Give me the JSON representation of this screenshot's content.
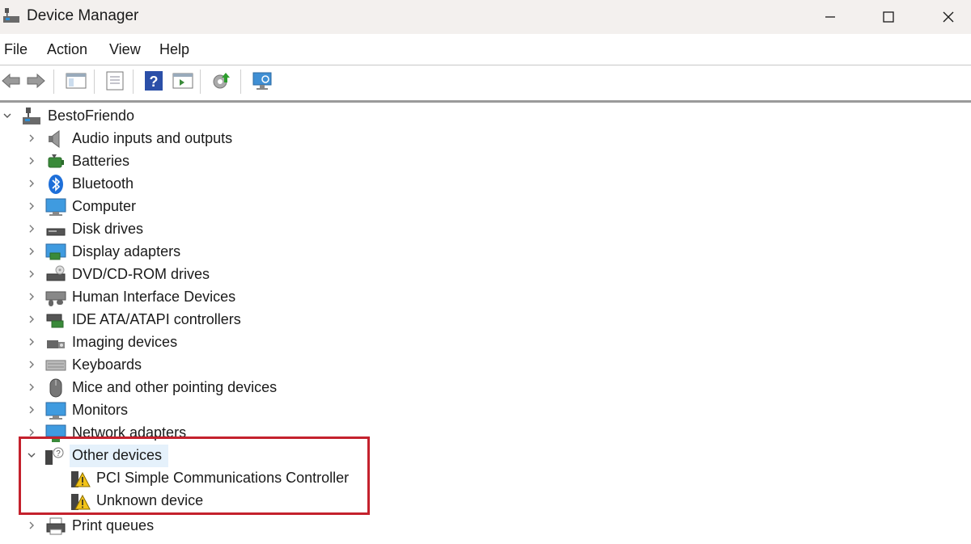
{
  "window": {
    "title": "Device Manager"
  },
  "menu": [
    "File",
    "Action",
    "View",
    "Help"
  ],
  "toolbar": {
    "buttons": [
      "back-icon",
      "forward-icon",
      "show-hide-console-tree-icon",
      "properties-icon",
      "help-icon",
      "action-pane-icon",
      "update-driver-icon",
      "scan-hardware-icon"
    ]
  },
  "tree": {
    "root": "BestoFriendo",
    "categories": [
      "Audio inputs and outputs",
      "Batteries",
      "Bluetooth",
      "Computer",
      "Disk drives",
      "Display adapters",
      "DVD/CD-ROM drives",
      "Human Interface Devices",
      "IDE ATA/ATAPI controllers",
      "Imaging devices",
      "Keyboards",
      "Mice and other pointing devices",
      "Monitors",
      "Network adapters"
    ],
    "other_devices": {
      "label": "Other devices",
      "children": [
        "PCI Simple Communications Controller",
        "Unknown device"
      ]
    },
    "after": [
      "Print queues"
    ]
  },
  "colors": {
    "highlight_border": "#c4212d",
    "selection": "#e5f1fb",
    "title_bar": "#f3f0ee"
  }
}
